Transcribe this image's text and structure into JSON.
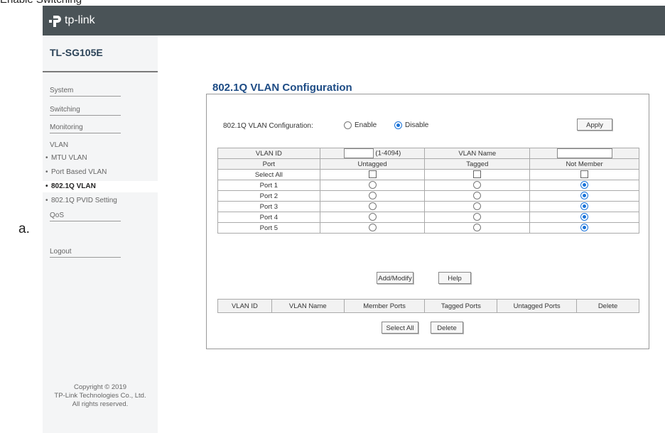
{
  "top_cut_text": "Enable Switching",
  "figure_label": "a.",
  "logo_text": "tp-link",
  "model": "TL-SG105E",
  "menu": {
    "system": "System",
    "switching": "Switching",
    "monitoring": "Monitoring",
    "vlan": "VLAN",
    "mtu_vlan": "MTU VLAN",
    "port_based_vlan": "Port Based VLAN",
    "dot1q_vlan": "802.1Q VLAN",
    "dot1q_pvid": "802.1Q PVID Setting",
    "qos": "QoS",
    "logout": "Logout"
  },
  "copyright": [
    "Copyright © 2019",
    "TP-Link Technologies Co., Ltd.",
    "All rights reserved."
  ],
  "section_title": "802.1Q VLAN Configuration",
  "config": {
    "label": "802.1Q VLAN Configuration:",
    "enable": "Enable",
    "disable": "Disable",
    "selected": "disable",
    "apply": "Apply"
  },
  "vlan_form": {
    "vlan_id_label": "VLAN ID",
    "vlan_id_value": "",
    "vlan_id_range": "(1-4094)",
    "vlan_name_label": "VLAN Name",
    "vlan_name_value": "",
    "headers": [
      "Port",
      "Untagged",
      "Tagged",
      "Not Member"
    ],
    "select_all": "Select All",
    "ports": [
      {
        "name": "Port 1",
        "selection": "not_member"
      },
      {
        "name": "Port 2",
        "selection": "not_member"
      },
      {
        "name": "Port 3",
        "selection": "not_member"
      },
      {
        "name": "Port 4",
        "selection": "not_member"
      },
      {
        "name": "Port 5",
        "selection": "not_member"
      }
    ]
  },
  "buttons": {
    "add_modify": "Add/Modify",
    "help": "Help",
    "select_all": "Select All",
    "delete": "Delete"
  },
  "summary_table": {
    "headers": [
      "VLAN ID",
      "VLAN Name",
      "Member Ports",
      "Tagged Ports",
      "Untagged Ports",
      "Delete"
    ]
  },
  "colors": {
    "topbar": "#4a5357",
    "title": "#1e4c85",
    "radio_selected": "#1a73d9"
  }
}
